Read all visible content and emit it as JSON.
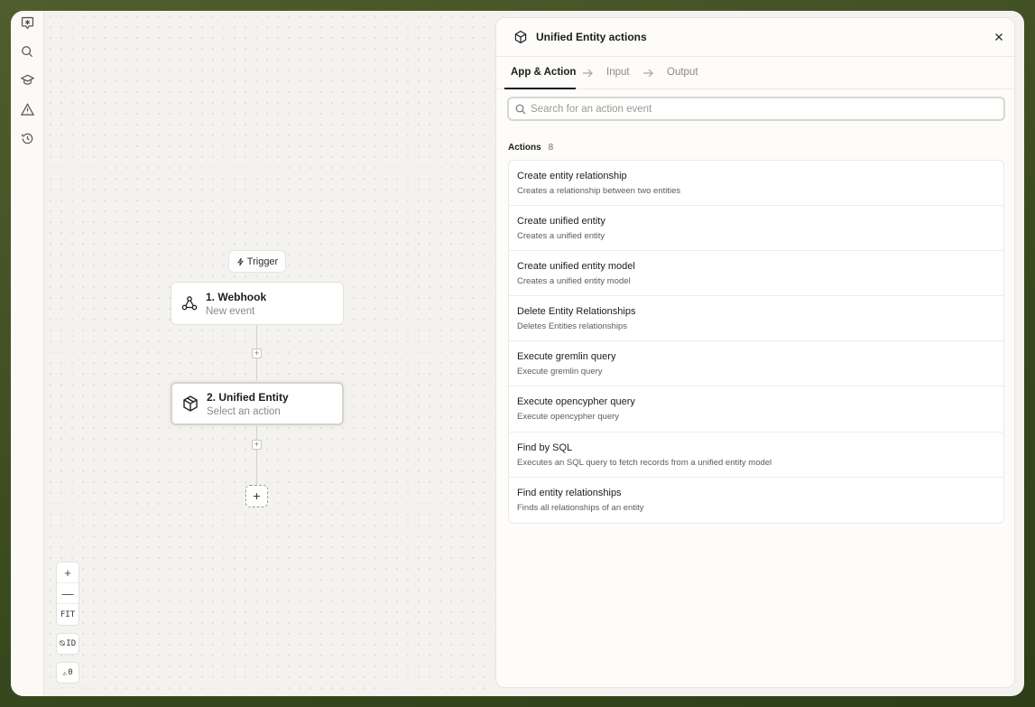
{
  "canvas": {
    "trigger_label": "Trigger",
    "nodes": [
      {
        "title": "1. Webhook",
        "subtitle": "New event",
        "icon": "webhook-icon"
      },
      {
        "title": "2. Unified Entity",
        "subtitle": "Select an action",
        "icon": "cube-icon"
      }
    ],
    "add_step_label": "+",
    "controls": {
      "zoom_in": "+",
      "zoom_out": "—",
      "fit": "FIT",
      "id_toggle": "ID",
      "warnings_count": "0"
    }
  },
  "panel": {
    "title": "Unified Entity actions",
    "tabs": [
      "App & Action",
      "Input",
      "Output"
    ],
    "active_tab": "App & Action",
    "search": {
      "placeholder": "Search for an action event",
      "value": ""
    },
    "actions_label": "Actions",
    "actions_count": "8",
    "actions": [
      {
        "title": "Create entity relationship",
        "description": "Creates a relationship between two entities"
      },
      {
        "title": "Create unified entity",
        "description": "Creates a unified entity"
      },
      {
        "title": "Create unified entity model",
        "description": "Creates a unified entity model"
      },
      {
        "title": "Delete Entity Relationships",
        "description": "Deletes Entities relationships"
      },
      {
        "title": "Execute gremlin query",
        "description": "Execute gremlin query"
      },
      {
        "title": "Execute opencypher query",
        "description": "Execute opencypher query"
      },
      {
        "title": "Find by SQL",
        "description": "Executes an SQL query to fetch records from a unified entity model"
      },
      {
        "title": "Find entity relationships",
        "description": "Finds all relationships of an entity"
      }
    ]
  },
  "rail_icons": [
    "logo-icon",
    "search-icon",
    "graduation-cap-icon",
    "warning-icon",
    "history-icon"
  ],
  "colors": {
    "frame_bg": "#4f5e2c",
    "canvas_bg": "#f3f2ee",
    "panel_bg": "#fdfcfa",
    "accent": "#1b1b18"
  }
}
